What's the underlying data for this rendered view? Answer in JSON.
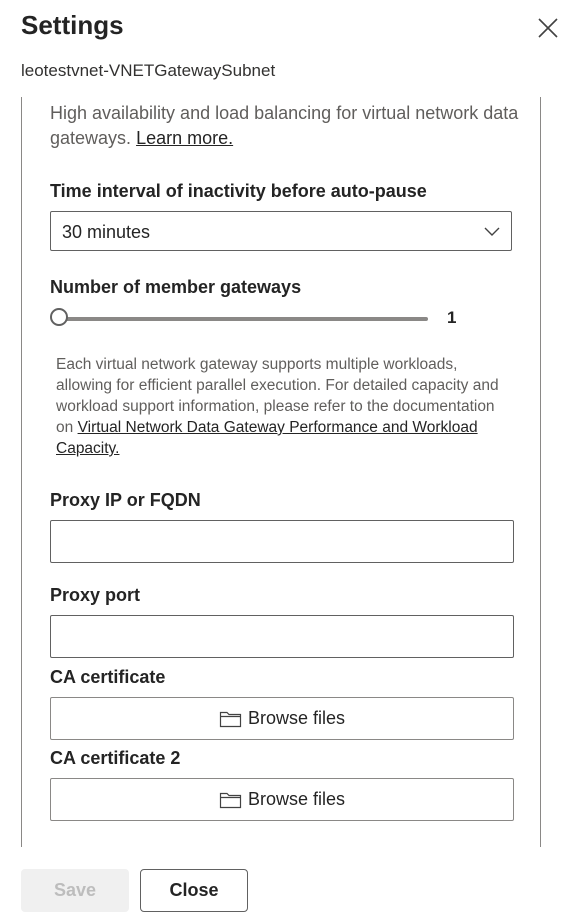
{
  "header": {
    "title": "Settings",
    "subtitle": "leotestvnet-VNETGatewaySubnet"
  },
  "intro": {
    "text": "High availability and load balancing for virtual network data gateways.",
    "link": "Learn more."
  },
  "autopause": {
    "label": "Time interval of inactivity before auto-pause",
    "value": "30 minutes"
  },
  "member_gateways": {
    "label": "Number of member gateways",
    "value": "1",
    "slider_fraction": 0
  },
  "note": {
    "text": "Each virtual network gateway supports multiple workloads, allowing for efficient parallel execution. For detailed capacity and workload support information, please refer to the documentation on",
    "link": "Virtual Network Data Gateway Performance and Workload Capacity."
  },
  "proxy_ip": {
    "label": "Proxy IP or FQDN",
    "value": ""
  },
  "proxy_port": {
    "label": "Proxy port",
    "value": ""
  },
  "ca_cert": {
    "label": "CA certificate",
    "button": "Browse files"
  },
  "ca_cert2": {
    "label": "CA certificate 2",
    "button": "Browse files"
  },
  "footer": {
    "save": "Save",
    "close": "Close"
  },
  "icons": {
    "close": "close-icon",
    "chevron": "chevron-down-icon",
    "folder": "folder-icon"
  }
}
